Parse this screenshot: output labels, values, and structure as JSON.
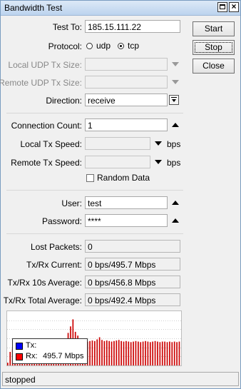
{
  "window": {
    "title": "Bandwidth Test"
  },
  "buttons": {
    "start": "Start",
    "stop": "Stop",
    "close": "Close"
  },
  "form": {
    "test_to": {
      "label": "Test To:",
      "value": "185.15.111.22"
    },
    "protocol": {
      "label": "Protocol:",
      "options": [
        "udp",
        "tcp"
      ],
      "selected": "tcp"
    },
    "local_udp_tx_size": {
      "label": "Local UDP Tx Size:",
      "value": ""
    },
    "remote_udp_tx_size": {
      "label": "Remote UDP Tx Size:",
      "value": ""
    },
    "direction": {
      "label": "Direction:",
      "value": "receive"
    },
    "connection_count": {
      "label": "Connection Count:",
      "value": "1"
    },
    "local_tx_speed": {
      "label": "Local Tx Speed:",
      "value": "",
      "unit": "bps"
    },
    "remote_tx_speed": {
      "label": "Remote Tx Speed:",
      "value": "",
      "unit": "bps"
    },
    "random_data": {
      "label": "Random Data",
      "checked": false
    },
    "user": {
      "label": "User:",
      "value": "test"
    },
    "password": {
      "label": "Password:",
      "value": "****"
    }
  },
  "stats": {
    "lost_packets": {
      "label": "Lost Packets:",
      "value": "0"
    },
    "current": {
      "label": "Tx/Rx Current:",
      "value": "0 bps/495.7 Mbps"
    },
    "avg10": {
      "label": "Tx/Rx 10s Average:",
      "value": "0 bps/456.8 Mbps"
    },
    "total_avg": {
      "label": "Tx/Rx Total Average:",
      "value": "0 bps/492.4 Mbps"
    }
  },
  "graph": {
    "legend": [
      {
        "name": "Tx:",
        "value": "",
        "color": "#0000ff"
      },
      {
        "name": "Rx:",
        "value": "495.7 Mbps",
        "color": "#ff0000"
      }
    ]
  },
  "chart_data": {
    "type": "bar",
    "series": [
      {
        "name": "Rx",
        "color": "#cc0000",
        "values": [
          0.05,
          0.25,
          0.3,
          0.3,
          0.31,
          0.32,
          0.3,
          0.33,
          0.32,
          0.34,
          0.33,
          0.35,
          0.34,
          0.36,
          0.35,
          0.37,
          0.38,
          0.37,
          0.4,
          0.39,
          0.42,
          0.41,
          0.45,
          0.44,
          0.5,
          0.6,
          0.72,
          0.85,
          0.62,
          0.55,
          0.5,
          0.47,
          0.45,
          0.44,
          0.45,
          0.46,
          0.45,
          0.48,
          0.52,
          0.47,
          0.45,
          0.46,
          0.45,
          0.44,
          0.45,
          0.46,
          0.47,
          0.45,
          0.44,
          0.45,
          0.44,
          0.43,
          0.44,
          0.45,
          0.44,
          0.43,
          0.44,
          0.45,
          0.44,
          0.43,
          0.44,
          0.45,
          0.44,
          0.43,
          0.44,
          0.44,
          0.43,
          0.44,
          0.43,
          0.44,
          0.43,
          0.44
        ]
      }
    ],
    "ylim": [
      0,
      1
    ],
    "grid": true
  },
  "status": {
    "text": "stopped"
  }
}
